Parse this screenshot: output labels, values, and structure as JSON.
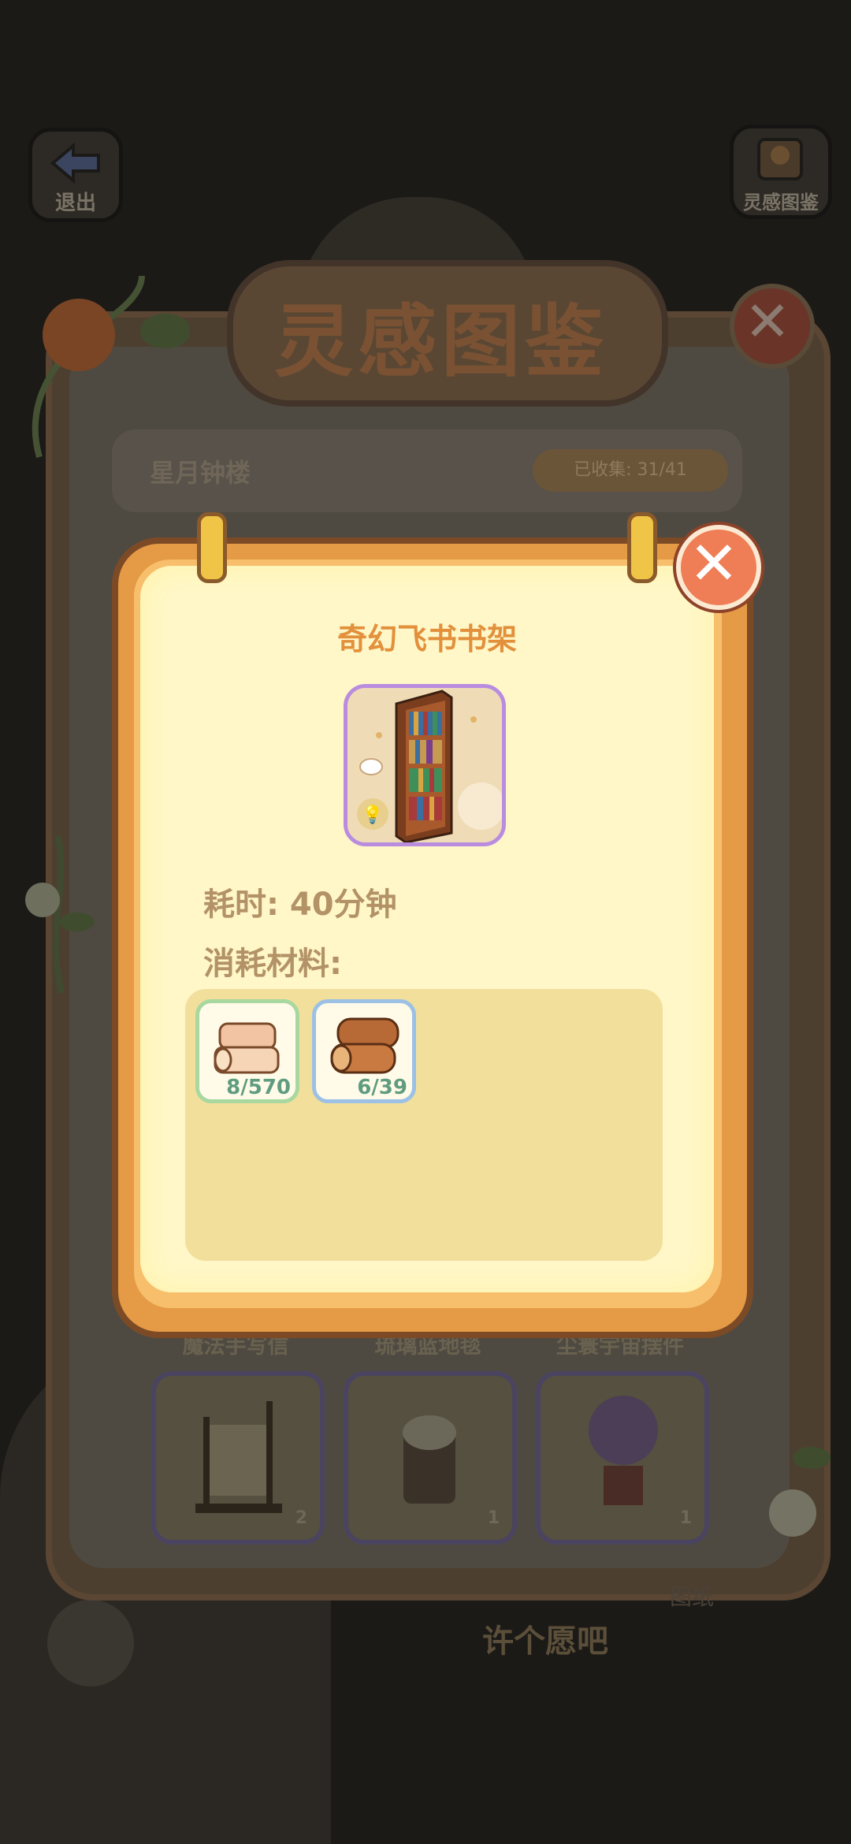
{
  "header": {
    "exit_label": "退出",
    "inspiration_codex_label": "灵感图鉴"
  },
  "codex": {
    "title": "灵感图鉴",
    "area_name": "星月钟楼",
    "collected": "已收集: 31/41",
    "items": [
      {
        "label": "魔法手写信",
        "count": "2"
      },
      {
        "label": "琉璃蓝地毯",
        "count": "1"
      },
      {
        "label": "尘寰宇宙摆件",
        "count": "1"
      }
    ]
  },
  "background": {
    "wish_label": "许个愿吧",
    "side_label": "图纸"
  },
  "popup": {
    "item_name": "奇幻飞书书架",
    "time_text": "耗时: 40分钟",
    "materials_label": "消耗材料:",
    "materials": [
      {
        "name": "pale-wood-plank-icon",
        "count": "8/570"
      },
      {
        "name": "wood-log-icon",
        "count": "6/39"
      }
    ]
  },
  "colors": {
    "popup_page": "#fff7c8",
    "popup_frame": "#e59a45",
    "title_orange": "#e2903b",
    "label_brown": "#b29266",
    "count_green": "#5f9c80",
    "close_button": "#ef7d56"
  }
}
